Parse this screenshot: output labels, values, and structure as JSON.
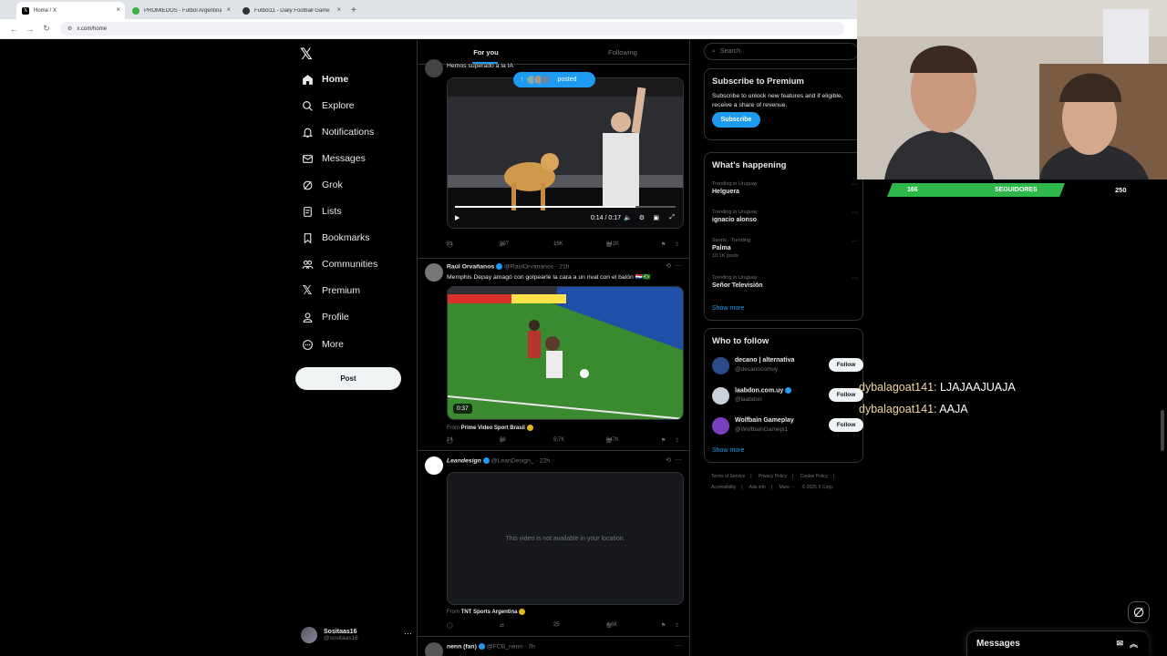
{
  "browser": {
    "tabs": [
      {
        "title": "Home / X",
        "icon": "x-logo-icon",
        "active": true,
        "color": "#000000"
      },
      {
        "title": "PROMIEDOS - Futbol Argentina",
        "icon": "promiedos-icon",
        "active": false,
        "color": "#3cb043"
      },
      {
        "title": "Futbol11 - Daily Football Game",
        "icon": "futbol11-icon",
        "active": false,
        "color": "#333333"
      }
    ],
    "url": "x.com/home"
  },
  "nav": {
    "items": [
      {
        "label": "Home",
        "icon": "home-icon"
      },
      {
        "label": "Explore",
        "icon": "search-icon"
      },
      {
        "label": "Notifications",
        "icon": "bell-icon"
      },
      {
        "label": "Messages",
        "icon": "envelope-icon"
      },
      {
        "label": "Grok",
        "icon": "grok-icon"
      },
      {
        "label": "Lists",
        "icon": "list-icon"
      },
      {
        "label": "Bookmarks",
        "icon": "bookmark-icon"
      },
      {
        "label": "Communities",
        "icon": "people-icon"
      },
      {
        "label": "Premium",
        "icon": "x-logo-icon"
      },
      {
        "label": "Profile",
        "icon": "person-icon"
      },
      {
        "label": "More",
        "icon": "more-circle-icon"
      }
    ],
    "post_label": "Post",
    "account": {
      "name": "Sositaas16",
      "handle": "@sositaas16"
    }
  },
  "feed": {
    "tabs": [
      "For you",
      "Following"
    ],
    "posted_pill": "posted",
    "post1": {
      "text": "Hemos superado a la IA",
      "video_time": "0:14 / 0:17",
      "progress": 0.82,
      "replies": "51",
      "reposts": "997",
      "likes": "19K",
      "views": "641K"
    },
    "post2": {
      "name": "Raúl Orvañanos",
      "handle": "@RaulOrvananos",
      "age": "· 21h",
      "text": "Memphis Depay amagó con golpearle la cara a un rival con el balón 🇳🇱🇧🇷",
      "duration": "0:37",
      "via_prefix": "From",
      "via": "Prime Video Sport Brasil",
      "replies": "14",
      "reposts": "88",
      "likes": "5.7K",
      "views": "847K"
    },
    "post3": {
      "name": "Leandesign",
      "handle": "@LeanDesign_",
      "age": "· 22h",
      "unavailable": "This video is not available in your location.",
      "via_prefix": "From",
      "via": "TNT Sports Argentina",
      "replies": "",
      "reposts": "",
      "likes": "25",
      "views": "4.8K"
    },
    "post4": {
      "name": "nenn (fan)",
      "handle": "@FCB_nenn",
      "age": "· 7h"
    }
  },
  "sidebar": {
    "search_placeholder": "Search",
    "premium": {
      "title": "Subscribe to Premium",
      "body": "Subscribe to unlock new features and if eligible, receive a share of revenue.",
      "button": "Subscribe"
    },
    "happening": {
      "title": "What's happening",
      "trends": [
        {
          "context": "Trending in Uruguay",
          "title": "Helguera",
          "count": ""
        },
        {
          "context": "Trending in Uruguay",
          "title": "ignacio alonso",
          "count": ""
        },
        {
          "context": "Sports · Trending",
          "title": "Palma",
          "count": "10.1K posts"
        },
        {
          "context": "Trending in Uruguay",
          "title": "Señor Televisión",
          "count": ""
        }
      ],
      "show_more": "Show more"
    },
    "who_to_follow": {
      "title": "Who to follow",
      "accounts": [
        {
          "name": "decano | alternativa",
          "handle": "@decanocomuy",
          "button": "Follow",
          "color": "#2b4a8a"
        },
        {
          "name": "laabdon.com.uy",
          "handle": "@laabdon",
          "button": "Follow",
          "color": "#c9d1d9"
        },
        {
          "name": "Wolfbain Gameplay",
          "handle": "@WolfbainGamepl1",
          "button": "Follow",
          "color": "#7a3fbf"
        }
      ],
      "show_more": "Show more"
    },
    "footer": {
      "line1": [
        "Terms of Service",
        "|",
        "Privacy Policy",
        "|",
        "Cookie Policy",
        "|"
      ],
      "line2": [
        "Accessibility",
        "|",
        "Ads info",
        "|",
        "More ···",
        "© 2025 X Corp."
      ]
    }
  },
  "overlay": {
    "followers_count": "166",
    "followers_label": "SEGUIDORES",
    "goal": "250",
    "chat": [
      {
        "user": "dybalagoat141:",
        "message": "LJAJAAJUAJA"
      },
      {
        "user": "dybalagoat141:",
        "message": "AAJA"
      }
    ]
  },
  "messages_bar": {
    "label": "Messages"
  },
  "colors": {
    "accent": "#1d9bf0",
    "follow_bar": "#2eb84a",
    "background": "#000000"
  }
}
